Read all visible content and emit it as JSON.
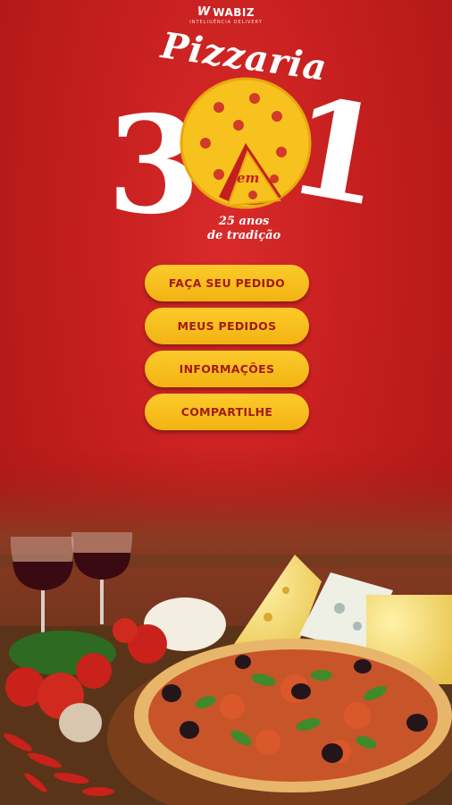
{
  "brand": {
    "mark": "W",
    "name": "WABIZ",
    "subtitle": "INTELIGÊNCIA DELIVERY"
  },
  "logo": {
    "word": "Pizzaria",
    "left_digit": "3",
    "connector": "em",
    "right_digit": "1",
    "tagline_line1": "25 anos",
    "tagline_line2": "de tradição"
  },
  "menu": {
    "order_label": "FAÇA SEU PEDIDO",
    "my_orders_label": "MEUS PEDIDOS",
    "info_label": "INFORMAÇÕES",
    "share_label": "COMPARTILHE"
  },
  "colors": {
    "background": "#c41e1e",
    "button": "#f7bf20",
    "button_text": "#a41b12",
    "pizza": "#f7c21d"
  }
}
